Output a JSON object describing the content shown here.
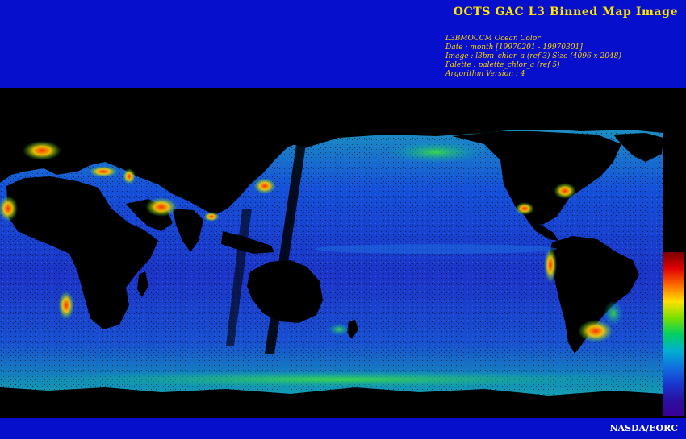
{
  "header": {
    "title": "OCTS GAC L3 Binned Map Image",
    "metadata_lines": [
      "L3BMOCCM Ocean Color",
      "Date : month [19970201 - 19970301]",
      "Image : l3bm_chlor_a (ref 3) Size (4096 x 2048)",
      "Palette : palette_chlor_a (ref 5)",
      "Argorithm Version : 4"
    ]
  },
  "footer": {
    "credit": "NASDA/EORC"
  },
  "colors": {
    "banner_background": "#0610cc",
    "title_text": "#ffe600",
    "land_and_nodata": "#000000",
    "ocean_low_chlorophyll": "#1c3cd6",
    "ocean_high_chlorophyll": "#ff2a00"
  },
  "colorbar": {
    "stops": [
      "#7a0000",
      "#e00000",
      "#ff6a00",
      "#ffe000",
      "#7ae000",
      "#00d060",
      "#00b0d0",
      "#1070e0",
      "#1838d0",
      "#2a10a0",
      "#3a0098"
    ]
  }
}
